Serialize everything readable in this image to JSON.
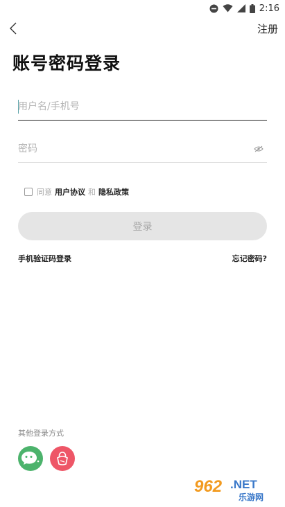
{
  "status_bar": {
    "time": "2:16",
    "icons": [
      "do-not-disturb-icon",
      "wifi-icon",
      "signal-icon",
      "battery-icon"
    ]
  },
  "nav": {
    "back_icon": "chevron-left-icon",
    "register_label": "注册"
  },
  "page_title": "账号密码登录",
  "form": {
    "username_placeholder": "用户名/手机号",
    "username_value": "",
    "password_placeholder": "密码",
    "password_value": "",
    "eye_icon": "eye-hidden-icon"
  },
  "agreement": {
    "prefix": "同意",
    "user_agreement": "用户协议",
    "conjunction": "和",
    "privacy_policy": "隐私政策",
    "checked": false
  },
  "login_button_label": "登录",
  "links": {
    "sms_login": "手机验证码登录",
    "forgot_password": "忘记密码?"
  },
  "other_login": {
    "label": "其他登录方式",
    "providers": [
      "wechat-icon",
      "lock-icon"
    ]
  },
  "colors": {
    "wechat": "#4cb36c",
    "other": "#ee5667",
    "button_disabled": "#e5e5e5",
    "caret": "#5ba3a8"
  },
  "watermark": {
    "number": "962",
    "suffix": ".NET",
    "text": "乐游网"
  }
}
